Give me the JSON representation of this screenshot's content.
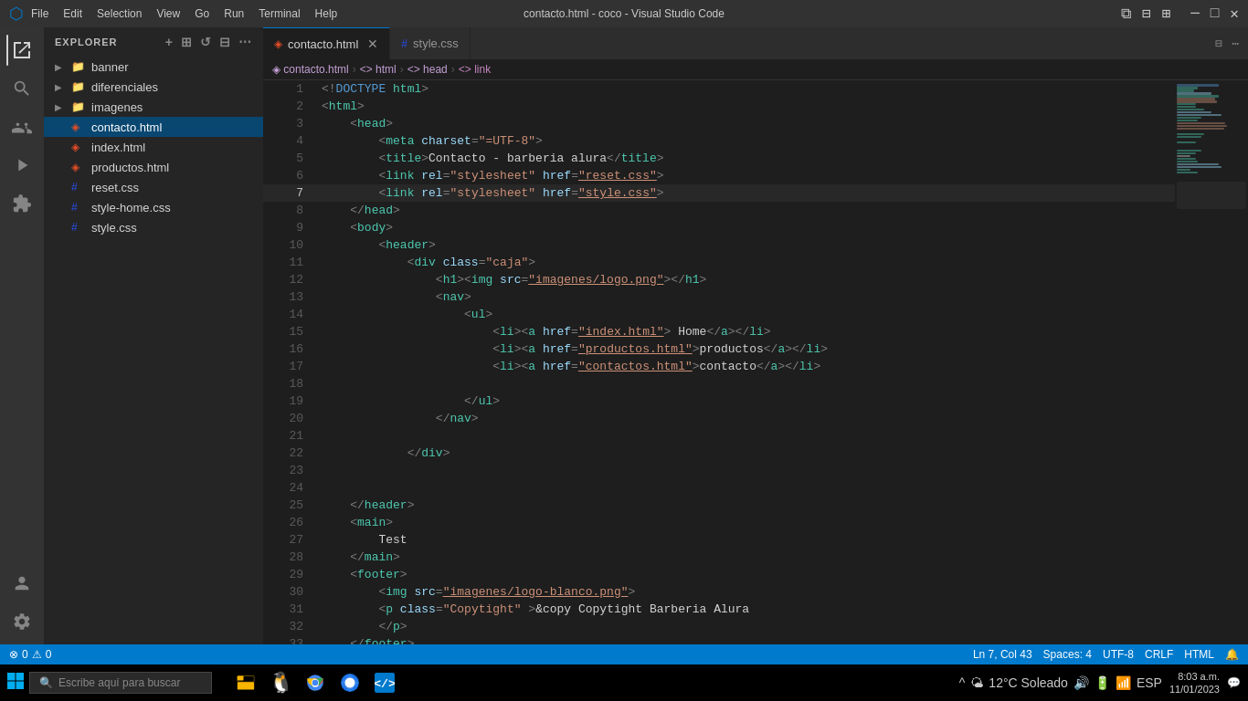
{
  "titleBar": {
    "menu": [
      "File",
      "Edit",
      "Selection",
      "View",
      "Go",
      "Run",
      "Terminal",
      "Help"
    ],
    "title": "contacto.html - coco - Visual Studio Code",
    "controls": [
      "⬜",
      "⬜",
      "✕"
    ]
  },
  "tabs": [
    {
      "id": "contacto",
      "label": "contacto.html",
      "type": "html",
      "active": true
    },
    {
      "id": "style",
      "label": "style.css",
      "type": "css",
      "active": false
    }
  ],
  "breadcrumb": [
    "contacto.html",
    "html",
    "head",
    "link"
  ],
  "sidebar": {
    "title": "EXPLORER",
    "items": [
      {
        "id": "banner",
        "label": "banner",
        "type": "folder",
        "indent": 0
      },
      {
        "id": "diferenciales",
        "label": "diferenciales",
        "type": "folder",
        "indent": 0
      },
      {
        "id": "imagenes",
        "label": "imagenes",
        "type": "folder",
        "indent": 0
      },
      {
        "id": "contacto",
        "label": "contacto.html",
        "type": "html",
        "indent": 0,
        "active": true
      },
      {
        "id": "index",
        "label": "index.html",
        "type": "html",
        "indent": 0
      },
      {
        "id": "productos",
        "label": "productos.html",
        "type": "html",
        "indent": 0
      },
      {
        "id": "reset",
        "label": "reset.css",
        "type": "css",
        "indent": 0
      },
      {
        "id": "stylehome",
        "label": "style-home.css",
        "type": "css",
        "indent": 0
      },
      {
        "id": "style",
        "label": "style.css",
        "type": "css",
        "indent": 0
      }
    ]
  },
  "code": {
    "lines": [
      {
        "num": 1,
        "content": "<!DOCTYPE html>"
      },
      {
        "num": 2,
        "content": "<html>"
      },
      {
        "num": 3,
        "content": "    <head>"
      },
      {
        "num": 4,
        "content": "        <meta charset=\"=UTF-8\">"
      },
      {
        "num": 5,
        "content": "        <title>Contacto - barberia alura</title>"
      },
      {
        "num": 6,
        "content": "        <link rel=\"stylesheet\" href=\"reset.css\">"
      },
      {
        "num": 7,
        "content": "        <link rel=\"stylesheet\" href=\"style.css\">",
        "active": true
      },
      {
        "num": 8,
        "content": "    </head>"
      },
      {
        "num": 9,
        "content": "    <body>"
      },
      {
        "num": 10,
        "content": "        <header>"
      },
      {
        "num": 11,
        "content": "            <div class=\"caja\">"
      },
      {
        "num": 12,
        "content": "                <h1><img src=\"imagenes/logo.png\"></h1>"
      },
      {
        "num": 13,
        "content": "                <nav>"
      },
      {
        "num": 14,
        "content": "                    <ul>"
      },
      {
        "num": 15,
        "content": "                        <li><a href=\"index.html\"> Home</a></li>"
      },
      {
        "num": 16,
        "content": "                        <li><a href=\"productos.html\">productos</a></li>"
      },
      {
        "num": 17,
        "content": "                        <li><a href=\"contactos.html\">contacto</a></li>"
      },
      {
        "num": 18,
        "content": ""
      },
      {
        "num": 19,
        "content": "                    </ul>"
      },
      {
        "num": 20,
        "content": "                </nav>"
      },
      {
        "num": 21,
        "content": ""
      },
      {
        "num": 22,
        "content": "            </div>"
      },
      {
        "num": 23,
        "content": ""
      },
      {
        "num": 24,
        "content": ""
      },
      {
        "num": 25,
        "content": "    </header>"
      },
      {
        "num": 26,
        "content": "    <main>"
      },
      {
        "num": 27,
        "content": "        Test"
      },
      {
        "num": 28,
        "content": "    </main>"
      },
      {
        "num": 29,
        "content": "    <footer>"
      },
      {
        "num": 30,
        "content": "        <img src=\"imagenes/logo-blanco.png\">"
      },
      {
        "num": 31,
        "content": "        <p class=\"Copytight\" >&copy Copytight Barberia Alura"
      },
      {
        "num": 32,
        "content": "        </p>"
      },
      {
        "num": 33,
        "content": "    </footer>"
      }
    ]
  },
  "statusBar": {
    "left": [
      "⊗ 0",
      "⚠ 0"
    ],
    "right": {
      "position": "Ln 7, Col 43",
      "spaces": "Spaces: 4",
      "encoding": "UTF-8",
      "lineEnding": "CRLF",
      "language": "HTML"
    }
  },
  "taskbar": {
    "searchPlaceholder": "Escribe aquí para buscar",
    "weather": "12°C  Soleado",
    "time": "8:03 a.m.",
    "date": "11/01/2023",
    "language": "ESP"
  }
}
